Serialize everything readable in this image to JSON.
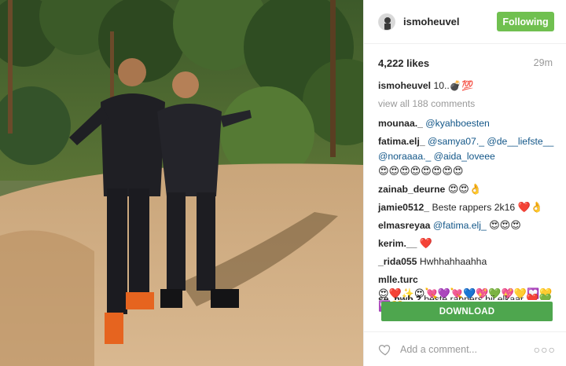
{
  "post": {
    "username": "ismoheuvel",
    "follow_label": "Following",
    "likes": "4,222 likes",
    "time": "29m"
  },
  "caption": {
    "user": "ismoheuvel",
    "text": "10..💣💯"
  },
  "view_all": "view all 188 comments",
  "comments": [
    {
      "user": "mounaa._",
      "mention": "@kyahboesten"
    },
    {
      "user": "fatima.elj_",
      "mention": "@samya07._ @de__liefste__ @noraaaa._ @aida_loveee",
      "emoji": "😍😍😍😍😍😍😍😍"
    },
    {
      "user": "zainab_deurne",
      "emoji": "😍😍👌"
    },
    {
      "user": "jamie0512_",
      "text": "Beste rappers 2k16",
      "emoji": "❤️👌"
    },
    {
      "user": "elmasreyaa",
      "mention": "@fatima.elj_",
      "emoji": "😍😍😍"
    },
    {
      "user": "kerim.__",
      "emoji": "❤️"
    },
    {
      "user": "_rida055",
      "text": "Hwhhahhaahha"
    },
    {
      "user": "mlle.turc",
      "emoji": "😍❤️✨😍💘💜💘💙💖💚💖💛💟💛💟💛"
    }
  ],
  "cut_comment": {
    "user": "se_nwb 2",
    "text": "beste rappers bij elkaar",
    "emoji": "❤️💚"
  },
  "download_label": "DOWNLOAD",
  "footer": {
    "add_comment_placeholder": "Add a comment...",
    "more": "○○○"
  },
  "colors": {
    "follow_green": "#70c050",
    "download_green": "#4ea64e",
    "mention_blue": "#125688"
  }
}
